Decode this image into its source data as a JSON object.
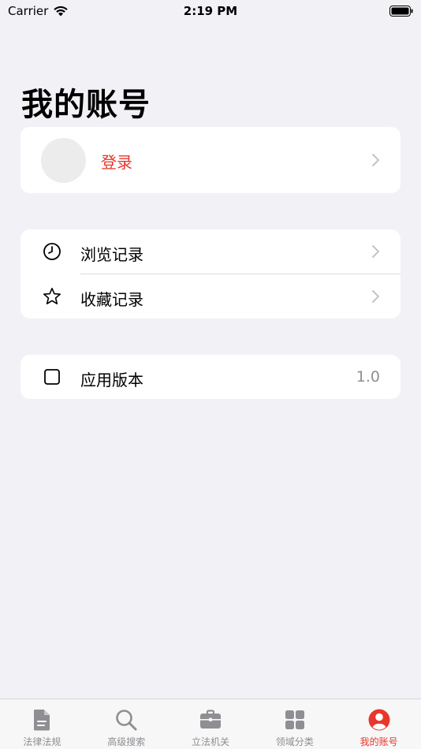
{
  "status_bar": {
    "carrier": "Carrier",
    "time": "2:19 PM"
  },
  "page": {
    "title": "我的账号"
  },
  "login": {
    "label": "登录"
  },
  "history": {
    "items": [
      {
        "label": "浏览记录",
        "icon": "clock-icon"
      },
      {
        "label": "收藏记录",
        "icon": "star-icon"
      }
    ]
  },
  "app_version": {
    "label": "应用版本",
    "value": "1.0",
    "icon": "square-icon"
  },
  "tab_bar": {
    "active_color": "#e8372c",
    "inactive_color": "#8e8e93",
    "tabs": [
      {
        "label": "法律法规",
        "icon": "document-icon"
      },
      {
        "label": "高级搜索",
        "icon": "search-icon"
      },
      {
        "label": "立法机关",
        "icon": "briefcase-icon"
      },
      {
        "label": "领域分类",
        "icon": "grid-icon"
      },
      {
        "label": "我的账号",
        "icon": "person-icon"
      }
    ]
  }
}
